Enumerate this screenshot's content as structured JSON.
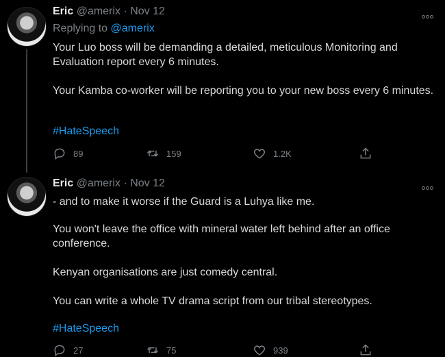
{
  "tweets": [
    {
      "name": "Eric",
      "handle": "@amerix",
      "sep": "·",
      "date": "Nov 12",
      "replying_prefix": "Replying to",
      "replying_handle": "@amerix",
      "paragraphs": [
        "Your Luo boss will be demanding a detailed, meticulous Monitoring and Evaluation report every 6 minutes.",
        "Your Kamba co-worker will be reporting you to your new boss every 6 minutes."
      ],
      "hashtag": "#HateSpeech",
      "replies": "89",
      "retweets": "159",
      "likes": "1.2K"
    },
    {
      "name": "Eric",
      "handle": "@amerix",
      "sep": "·",
      "date": "Nov 12",
      "paragraphs": [
        "- and to make it worse if the Guard is a Luhya like me.",
        "You won't leave the office with mineral water left behind after an office conference.",
        "Kenyan organisations are just comedy central.",
        "You can write a whole TV drama script from our tribal stereotypes."
      ],
      "hashtag": "#HateSpeech",
      "replies": "27",
      "retweets": "75",
      "likes": "939"
    }
  ]
}
